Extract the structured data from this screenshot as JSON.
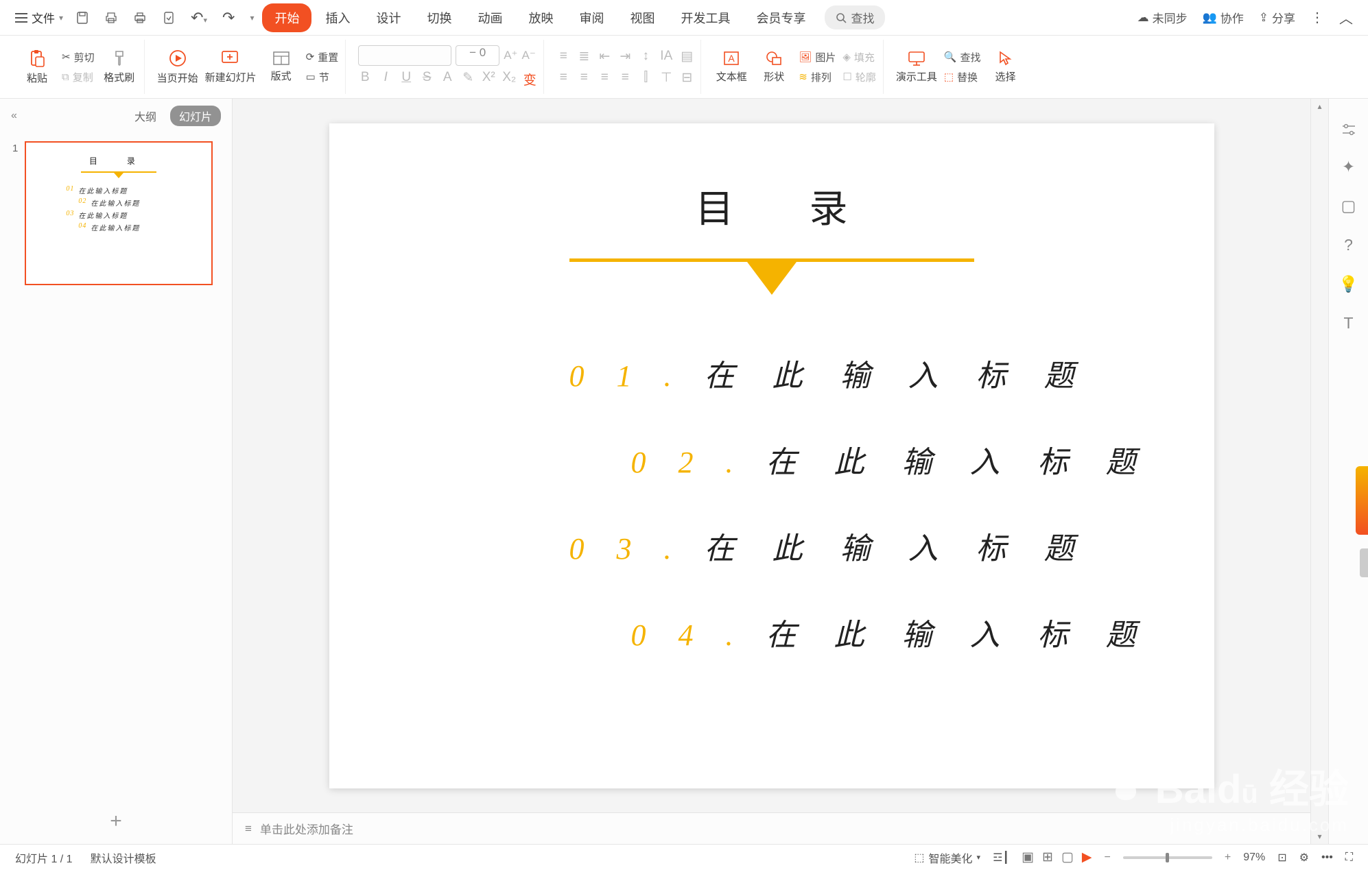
{
  "file_menu": "文件",
  "tabs": {
    "start": "开始",
    "insert": "插入",
    "design": "设计",
    "transition": "切换",
    "animation": "动画",
    "slideshow": "放映",
    "review": "审阅",
    "view": "视图",
    "devtools": "开发工具",
    "member": "会员专享"
  },
  "search": "查找",
  "top_right": {
    "unsync": "未同步",
    "collab": "协作",
    "share": "分享"
  },
  "ribbon": {
    "paste": "粘贴",
    "cut": "剪切",
    "copy": "复制",
    "format_painter": "格式刷",
    "page_start": "当页开始",
    "new_slide": "新建幻灯片",
    "layout": "版式",
    "section": "节",
    "reset": "重置",
    "font_size_minus": "− 0",
    "textbox": "文本框",
    "shape": "形状",
    "picture": "图片",
    "arrange": "排列",
    "fill": "填充",
    "outline": "轮廓",
    "demo_tools": "演示工具",
    "find": "查找",
    "replace": "替换",
    "select": "选择"
  },
  "panel": {
    "outline": "大纲",
    "slides": "幻灯片",
    "num": "1"
  },
  "slide": {
    "title": "目录",
    "items": [
      {
        "num": "0 1 .",
        "text": "在 此 输 入 标 题"
      },
      {
        "num": "0 2 .",
        "text": "在 此 输 入 标 题"
      },
      {
        "num": "0 3 .",
        "text": "在 此 输 入 标 题"
      },
      {
        "num": "0 4 .",
        "text": "在 此 输 入 标 题"
      }
    ]
  },
  "thumb_title": "目  录",
  "thumb_items": [
    {
      "n": "01",
      "t": "在此输入标题"
    },
    {
      "n": "02",
      "t": "在此输入标题"
    },
    {
      "n": "03",
      "t": "在此输入标题"
    },
    {
      "n": "04",
      "t": "在此输入标题"
    }
  ],
  "notes_placeholder": "单击此处添加备注",
  "status": {
    "slide_count": "幻灯片 1 / 1",
    "template": "默认设计模板",
    "beautify": "智能美化",
    "zoom": "97%"
  },
  "watermark": {
    "brand": "Baid",
    "label": "经验",
    "url": "jingyan.baidu.com"
  }
}
